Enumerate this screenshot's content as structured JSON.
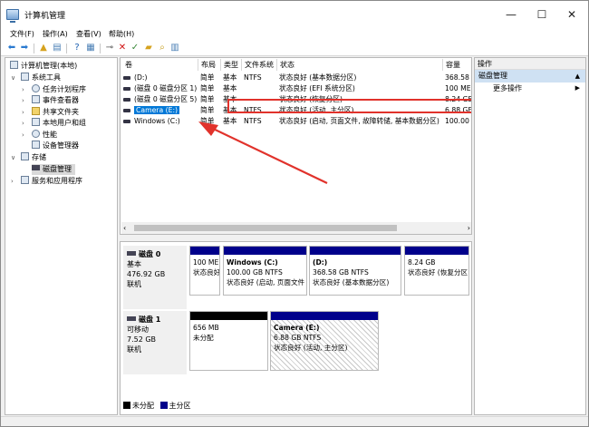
{
  "window": {
    "title": "计算机管理",
    "controls": [
      "—",
      "☐",
      "✕"
    ]
  },
  "menu": [
    "文件(F)",
    "操作(A)",
    "查看(V)",
    "帮助(H)"
  ],
  "tree": [
    {
      "label": "计算机管理(本地)",
      "level": 0
    },
    {
      "label": "系统工具",
      "level": 1,
      "expanded": true
    },
    {
      "label": "任务计划程序",
      "level": 2
    },
    {
      "label": "事件查看器",
      "level": 2
    },
    {
      "label": "共享文件夹",
      "level": 2
    },
    {
      "label": "本地用户和组",
      "level": 2
    },
    {
      "label": "性能",
      "level": 2
    },
    {
      "label": "设备管理器",
      "level": 2
    },
    {
      "label": "存储",
      "level": 1,
      "expanded": true
    },
    {
      "label": "磁盘管理",
      "level": 2,
      "selected": true
    },
    {
      "label": "服务和应用程序",
      "level": 1
    }
  ],
  "list": {
    "columns": [
      "卷",
      "布局",
      "类型",
      "文件系统",
      "状态",
      "容量"
    ],
    "rows": [
      [
        "(D:)",
        "简单",
        "基本",
        "NTFS",
        "状态良好 (基本数据分区)",
        "368.58"
      ],
      [
        "(磁盘 0 磁盘分区 1)",
        "简单",
        "基本",
        "",
        "状态良好 (EFI 系统分区)",
        "100 ME"
      ],
      [
        "(磁盘 0 磁盘分区 5)",
        "简单",
        "基本",
        "",
        "状态良好 (恢复分区)",
        "8.24 GE"
      ],
      [
        "Camera (E:)",
        "简单",
        "基本",
        "NTFS",
        "状态良好 (活动, 主分区)",
        "6.88 GE"
      ],
      [
        "Windows (C:)",
        "简单",
        "基本",
        "NTFS",
        "状态良好 (启动, 页面文件, 故障转储, 基本数据分区)",
        "100.00"
      ]
    ]
  },
  "disks": [
    {
      "name": "磁盘 0",
      "type": "基本",
      "size": "476.92 GB",
      "status": "联机",
      "parts": [
        {
          "lines": [
            "",
            "100 ME",
            "状态良好"
          ]
        },
        {
          "lines": [
            "Windows  (C:)",
            "100.00 GB NTFS",
            "状态良好 (启动, 页面文件"
          ]
        },
        {
          "lines": [
            "(D:)",
            "368.58 GB NTFS",
            "状态良好 (基本数据分区)"
          ]
        },
        {
          "lines": [
            "",
            "8.24 GB",
            "状态良好 (恢复分区"
          ]
        }
      ]
    },
    {
      "name": "磁盘 1",
      "type": "可移动",
      "size": "7.52 GB",
      "status": "联机",
      "parts": [
        {
          "lines": [
            "",
            "656 MB",
            "未分配"
          ]
        },
        {
          "lines": [
            "Camera  (E:)",
            "6.88 GB NTFS",
            "状态良好 (活动, 主分区)"
          ]
        }
      ]
    }
  ],
  "legend": [
    {
      "label": "未分配",
      "color": "#000000"
    },
    {
      "label": "主分区",
      "color": "#00008b"
    }
  ],
  "actions": {
    "header": "操作",
    "selected": "磁盘管理",
    "items": [
      "更多操作"
    ]
  },
  "colors": {
    "primary_partition": "#00008b",
    "unallocated": "#000000",
    "highlight": "#0078d7",
    "annotation": "#e1322b"
  }
}
